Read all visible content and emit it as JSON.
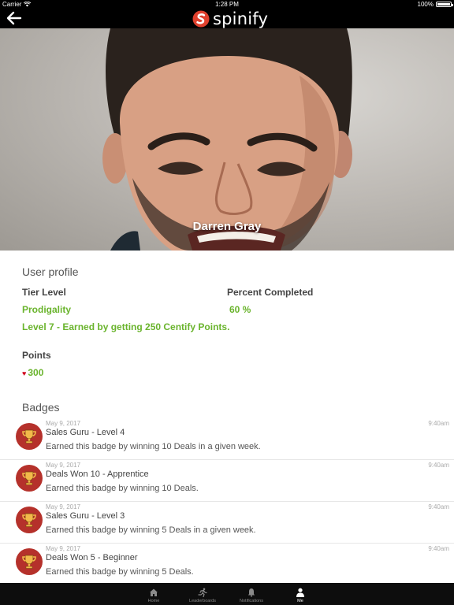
{
  "status_bar": {
    "carrier": "Carrier",
    "time": "1:28 PM",
    "battery": "100%"
  },
  "nav": {
    "brand": "spinify",
    "back_icon": "arrow-left-icon",
    "logo_icon": "spinify-logo-icon"
  },
  "hero": {
    "name": "Darren Gray"
  },
  "profile": {
    "section_title": "User profile",
    "tier_label": "Tier Level",
    "tier_value": "Prodigality",
    "tier_description": "Level 7 - Earned by getting 250 Centify Points.",
    "percent_label": "Percent Completed",
    "percent_value": "60 %",
    "points_label": "Points",
    "points_value": "300",
    "points_icon": "heart-icon"
  },
  "badges": {
    "section_title": "Badges",
    "items": [
      {
        "date": "May 9, 2017",
        "time": "9:40am",
        "name": "Sales Guru - Level 4",
        "description": "Earned this badge by winning 10 Deals in a given week.",
        "icon": "trophy-icon"
      },
      {
        "date": "May 9, 2017",
        "time": "9:40am",
        "name": "Deals Won 10 - Apprentice",
        "description": "Earned this badge by winning 10 Deals.",
        "icon": "trophy-icon"
      },
      {
        "date": "May 9, 2017",
        "time": "9:40am",
        "name": "Sales Guru - Level 3",
        "description": "Earned this badge by winning 5 Deals in a given week.",
        "icon": "trophy-icon"
      },
      {
        "date": "May 9, 2017",
        "time": "9:40am",
        "name": "Deals Won 5 - Beginner",
        "description": "Earned this badge by winning 5 Deals.",
        "icon": "trophy-icon"
      }
    ]
  },
  "tab_bar": {
    "tabs": [
      {
        "label": "Home",
        "icon": "home-icon",
        "active": false
      },
      {
        "label": "Leaderboards",
        "icon": "runner-icon",
        "active": false
      },
      {
        "label": "Notifications",
        "icon": "bell-icon",
        "active": false
      },
      {
        "label": "Me",
        "icon": "person-icon",
        "active": true
      }
    ]
  },
  "colors": {
    "accent_green": "#6ab42d",
    "badge_red": "#b5312b",
    "heart_red": "#d0021b",
    "brand_red": "#e0412e"
  }
}
